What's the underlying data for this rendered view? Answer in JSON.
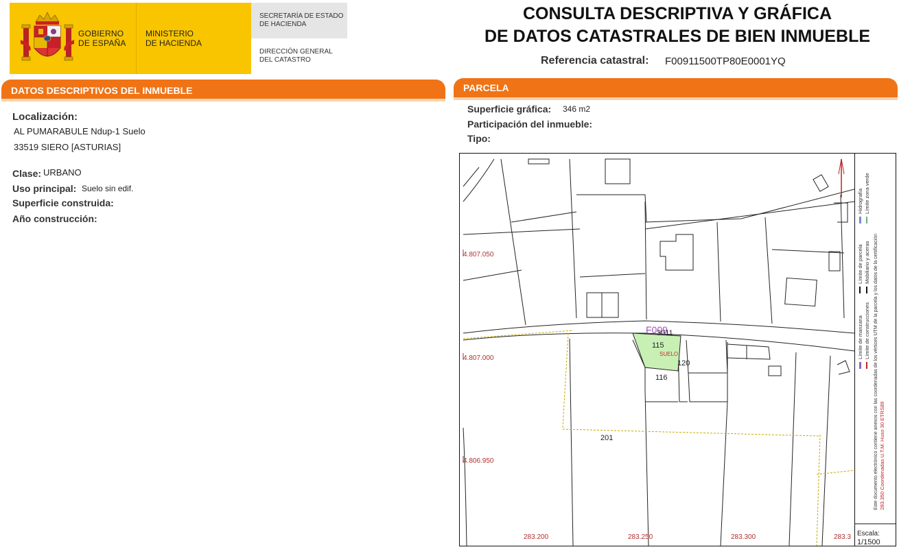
{
  "header": {
    "gobierno_line1": "GOBIERNO",
    "gobierno_line2": "DE ESPAÑA",
    "ministerio_line1": "MINISTERIO",
    "ministerio_line2": "DE HACIENDA",
    "secretaria": "SECRETARÍA DE ESTADO\nDE HACIENDA",
    "direccion": "DIRECCIÓN GENERAL\nDEL CATASTRO",
    "title_line1": "CONSULTA DESCRIPTIVA Y GRÁFICA",
    "title_line2": "DE DATOS CATASTRALES DE BIEN INMUEBLE",
    "refcat_label": "Referencia catastral:",
    "refcat_value": "F00911500TP80E0001YQ"
  },
  "descriptivos": {
    "heading": "DATOS DESCRIPTIVOS DEL INMUEBLE",
    "localizacion_label": "Localización:",
    "localizacion_line1": "AL PUMARABULE Ndup-1 Suelo",
    "localizacion_line2": "33519 SIERO [ASTURIAS]",
    "clase_label": "Clase:",
    "clase_value": "URBANO",
    "uso_label": "Uso principal:",
    "uso_value": "Suelo sin edif.",
    "superficie_label": "Superficie construida:",
    "anio_label": "Año construcción:"
  },
  "parcela": {
    "heading": "PARCELA",
    "superficie_label": "Superficie gráfica:",
    "superficie_value": "346 m2",
    "participacion_label": "Participación del inmueble:",
    "tipo_label": "Tipo:"
  },
  "map": {
    "y_labels": [
      "4.807.050",
      "4.807.000",
      "4.806.950"
    ],
    "x_labels": [
      "283.200",
      "283.250",
      "283.300",
      "283.3"
    ],
    "parcel_labels": [
      "F009",
      "3011",
      "115",
      "SUELO",
      "120",
      "116",
      "201"
    ],
    "highlight_color": "#c8f0b4",
    "coord_color": "#b03030"
  },
  "legend": {
    "items": [
      "Límite de manzana",
      "Límite de parcela",
      "Hidrografía",
      "Límite de construcciones",
      "Mobiliario y aceras",
      "Límite zona verde"
    ],
    "note": "Este documento electrónico contiene anexos con las coordenadas de los vértices UTM de la parcela y los datos de la certificación",
    "coords": "283.350 Coordenadas U.T.M. Huso 30 ETRS89",
    "escala_label": "Escala:",
    "escala_value": "1/1500"
  }
}
